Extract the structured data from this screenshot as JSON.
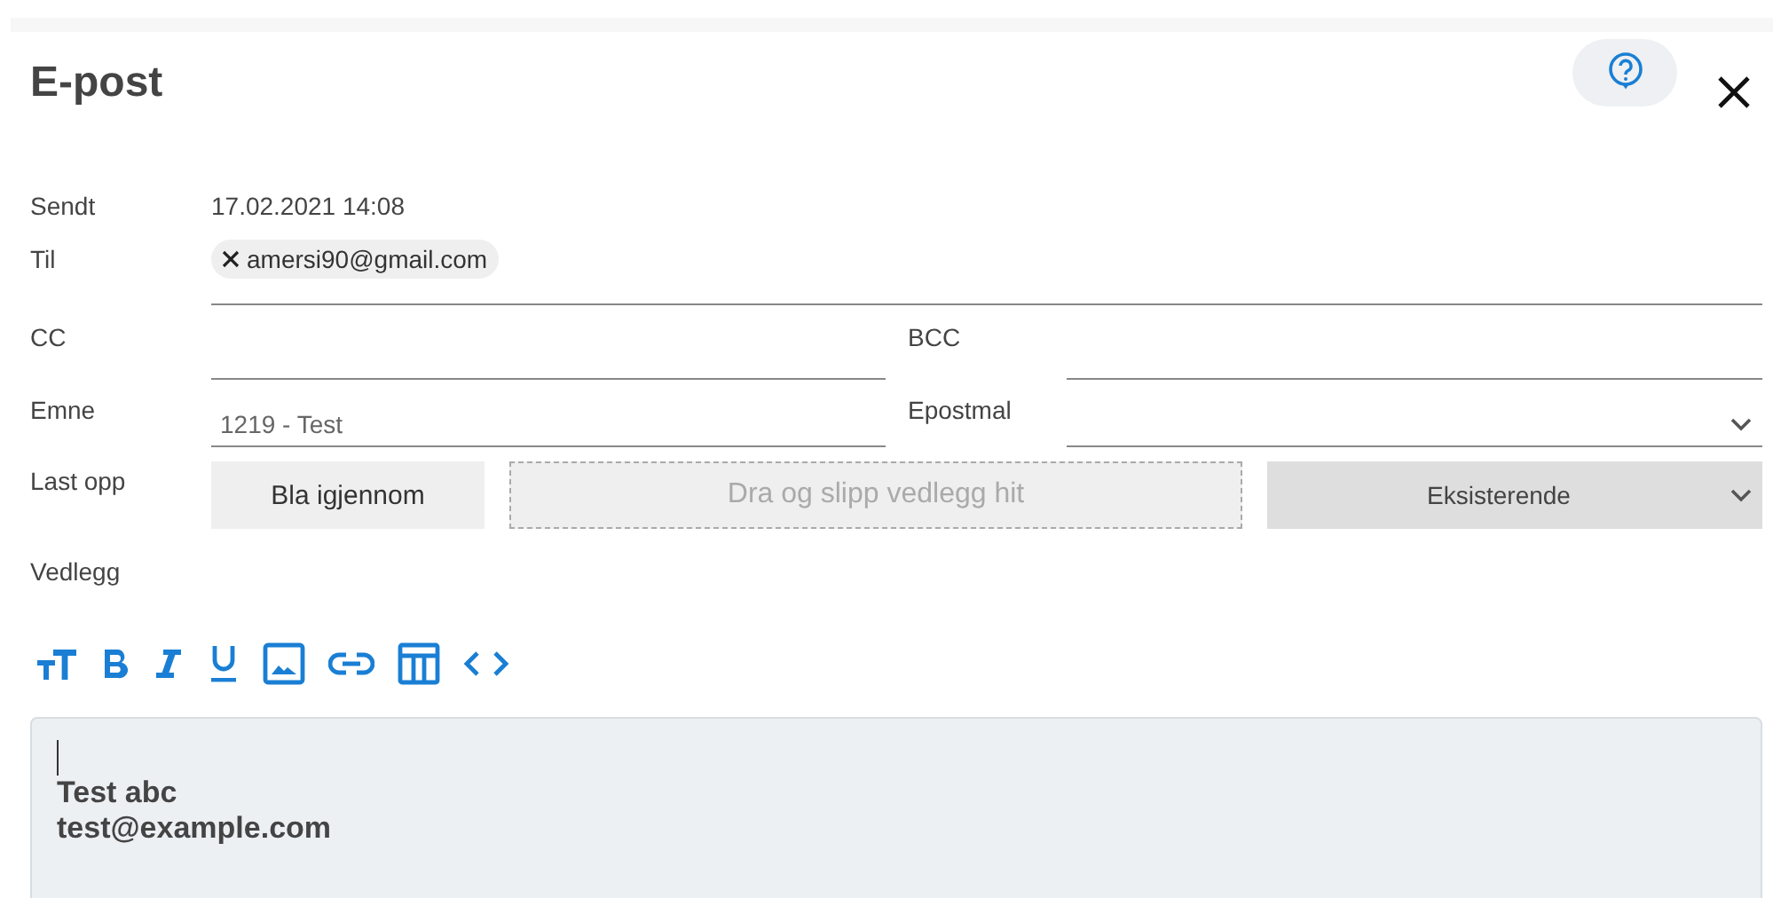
{
  "title": "E-post",
  "sent": {
    "label": "Sendt",
    "value": "17.02.2021 14:08"
  },
  "to": {
    "label": "Til",
    "recipients": [
      "amersi90@gmail.com"
    ]
  },
  "cc": {
    "label": "CC"
  },
  "bcc": {
    "label": "BCC"
  },
  "subject": {
    "label": "Emne",
    "value": "1219 - Test"
  },
  "template": {
    "label": "Epostmal"
  },
  "upload": {
    "label": "Last opp",
    "browse_button": "Bla igjennom",
    "dropzone": "Dra og slipp vedlegg hit",
    "existing_select": "Eksisterende"
  },
  "attachments": {
    "label": "Vedlegg"
  },
  "editor": {
    "lines": [
      "Test abc",
      "test@example.com"
    ]
  }
}
